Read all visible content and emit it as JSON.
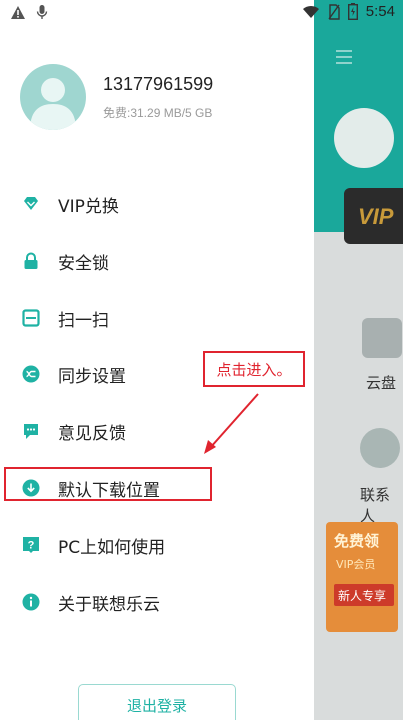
{
  "status_bar": {
    "time": "5:54",
    "icons": [
      "warning-icon",
      "mic-icon",
      "wifi-icon",
      "no-sim-icon",
      "battery-icon"
    ]
  },
  "profile": {
    "phone": "13177961599",
    "storage": "免费:31.29 MB/5 GB"
  },
  "menu": {
    "items": [
      {
        "label": "VIP兑换",
        "icon": "diamond-icon"
      },
      {
        "label": "安全锁",
        "icon": "lock-icon"
      },
      {
        "label": "扫一扫",
        "icon": "scan-icon"
      },
      {
        "label": "同步设置",
        "icon": "sync-icon"
      },
      {
        "label": "意见反馈",
        "icon": "feedback-icon"
      },
      {
        "label": "默认下载位置",
        "icon": "download-icon"
      },
      {
        "label": "PC上如何使用",
        "icon": "help-icon"
      },
      {
        "label": "关于联想乐云",
        "icon": "info-icon"
      }
    ]
  },
  "annotation": {
    "callout_text": "点击进入。"
  },
  "logout": {
    "label": "退出登录"
  },
  "background_app": {
    "vip_badge": "VIP",
    "cloud_label": "云盘",
    "contacts_label": "联系人",
    "promo_line1": "免费领",
    "promo_line2": "VIP会员",
    "promo_line3": "新人专享"
  },
  "colors": {
    "accent": "#1fb2a4",
    "highlight": "#e0242f"
  }
}
